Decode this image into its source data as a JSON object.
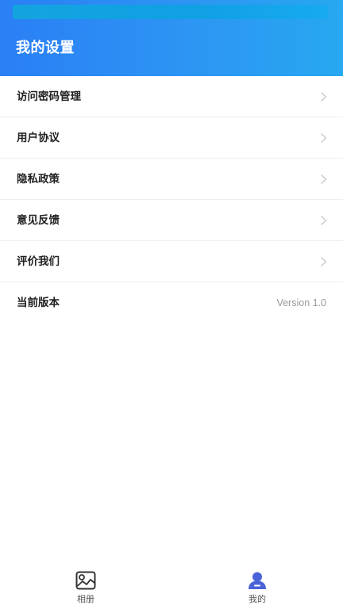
{
  "header": {
    "title": "我的设置"
  },
  "menu": {
    "items": [
      {
        "label": "访问密码管理",
        "icon": "chevron-right-icon"
      },
      {
        "label": "用户协议",
        "icon": "chevron-right-icon"
      },
      {
        "label": "隐私政策",
        "icon": "chevron-right-icon"
      },
      {
        "label": "意见反馈",
        "icon": "chevron-right-icon"
      },
      {
        "label": "评价我们",
        "icon": "chevron-right-icon"
      }
    ],
    "version": {
      "label": "当前版本",
      "value": "Version 1.0"
    }
  },
  "tabbar": {
    "tabs": [
      {
        "label": "相册",
        "icon": "album-icon",
        "active": false
      },
      {
        "label": "我的",
        "icon": "user-icon",
        "active": true
      }
    ]
  },
  "colors": {
    "header_start": "#2a7ff5",
    "header_end": "#27a8f0",
    "active_icon": "#4a63d8",
    "chevron": "#c8c8c8",
    "version_text": "#999999"
  }
}
